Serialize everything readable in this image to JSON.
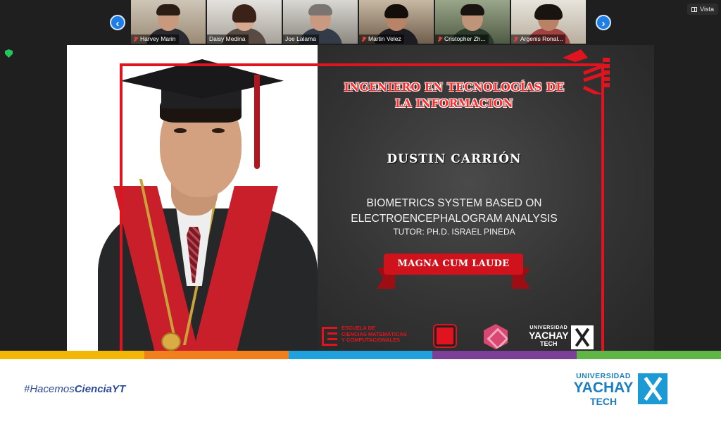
{
  "meeting": {
    "participants": [
      {
        "name": "Harvey Marin"
      },
      {
        "name": "Daisy Medina"
      },
      {
        "name": "Joe Lalama"
      },
      {
        "name": "Martin Velez"
      },
      {
        "name": "Cristopher Zh..."
      },
      {
        "name": "Argenis Ronal..."
      }
    ],
    "prev_label": "‹",
    "next_label": "›",
    "view_button_label": "Vista"
  },
  "slide": {
    "title": "INGENIERO EN TECNOLOGÍAS DE LA INFORMACION",
    "graduate_name": "DUSTIN CARRIÓN",
    "thesis_line1": "BIOMETRICS SYSTEM BASED ON",
    "thesis_line2": "ELECTROENCEPHALOGRAM ANALYSIS",
    "tutor": "TUTOR: PH.D. ISRAEL PINEDA",
    "honor": "MAGNA CUM LAUDE",
    "school_line1": "ESCUELA DE",
    "school_line2": "CIENCIAS MATEMÁTICAS",
    "school_line3": "Y COMPUTACIONALES",
    "university_line1": "UNIVERSIDAD",
    "university_line2": "YACHAY",
    "university_line3": "TECH"
  },
  "banner": {
    "hashtag_prefix": "#Hacemos",
    "hashtag_bold": "CienciaYT",
    "university_line1": "UNIVERSIDAD",
    "university_line2": "YACHAY",
    "university_line3": "TECH"
  },
  "colors": {
    "accent_red": "#e0141e",
    "brand_blue": "#1c7ec2",
    "nav_blue": "#1e7ee6",
    "stripe": [
      "#f2b705",
      "#f07f1c",
      "#1fa1dd",
      "#7b3f98",
      "#5fb646"
    ]
  }
}
